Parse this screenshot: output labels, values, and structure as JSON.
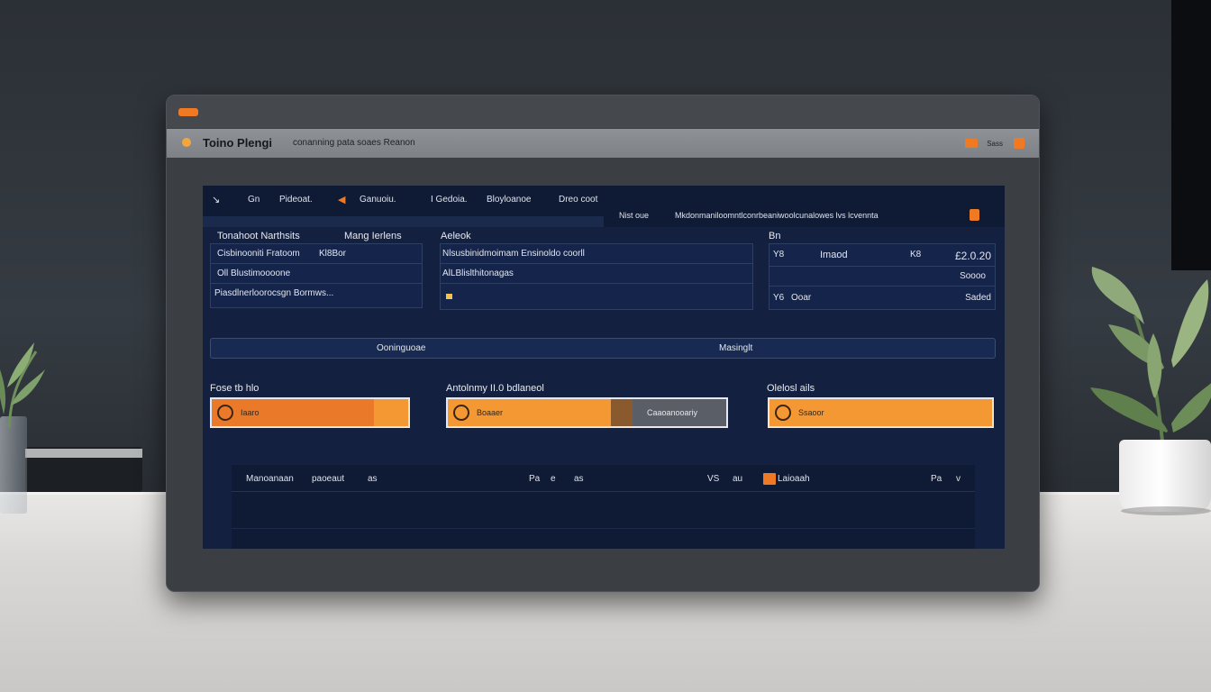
{
  "titlebar": {
    "brand_icon": "brand-icon"
  },
  "app": {
    "title": "Toino Plengi",
    "subtitle": "conanning pata soaes Reanon",
    "controls_label": "Sass"
  },
  "nav": {
    "items": [
      {
        "icon": "arrow-icon",
        "label": ""
      },
      {
        "icon": "",
        "label": "Gn"
      },
      {
        "icon": "",
        "label": "Pideoat."
      },
      {
        "icon": "flag-icon",
        "label": "Ganuoiu."
      },
      {
        "icon": "",
        "label": "I Gedoia."
      },
      {
        "icon": "",
        "label": "Bloyloanoe"
      },
      {
        "icon": "",
        "label": "Dreo coot"
      }
    ],
    "search_label": "Nist oue",
    "search_text": "Mkdonmaniloomntlconrbeaniwoolcunalowes lvs lcvennta"
  },
  "panels": {
    "left": {
      "label_a": "Tonahoot Narthsits",
      "label_b": "Mang Ierlens",
      "rows": [
        {
          "text": "Cisbinooniti Fratoom",
          "accent": "Kl8Bor"
        },
        {
          "text": "Oll Blustimoooone"
        },
        {
          "text": "Piasdlnerloorocsgn Bormws..."
        }
      ]
    },
    "middle": {
      "label": "Aeleok",
      "rows": [
        {
          "text": "Nlsusbinidmoimam Ensinoldo coorll"
        },
        {
          "text": "AlLBlislthitonagas"
        },
        {
          "text": ""
        }
      ]
    },
    "right": {
      "label": "Bn",
      "rows": [
        {
          "icon": "Y8",
          "label": "Imaod",
          "accent": "K8",
          "value": "£2.0.20"
        },
        {
          "value": "Soooo"
        },
        {
          "icon": "Y6",
          "label": "Ooar",
          "value": "Saded"
        }
      ]
    }
  },
  "widebar": {
    "left": "Ooninguoae",
    "right": "Masinglt"
  },
  "cards": [
    {
      "title": "Fose tb hlo",
      "label": "Iaaro"
    },
    {
      "title": "Antolnmy II.0  bdlaneol",
      "label": "Boaaer",
      "side": "Caaoanooariy"
    },
    {
      "title": "Olelosl ails",
      "label": "Ssaoor"
    }
  ],
  "table": {
    "col_a": "Manoanaan",
    "col_b": "paoeaut",
    "col_c": "as",
    "col_d": "Pa",
    "col_e": "e",
    "col_f": "as",
    "col_g": "VS",
    "col_h": "au",
    "col_i": "Laioaah",
    "col_j": "Pa",
    "col_k": "v"
  },
  "colors": {
    "accent": "#f07a24",
    "screen_bg": "#13203f",
    "card": "#f39833"
  }
}
